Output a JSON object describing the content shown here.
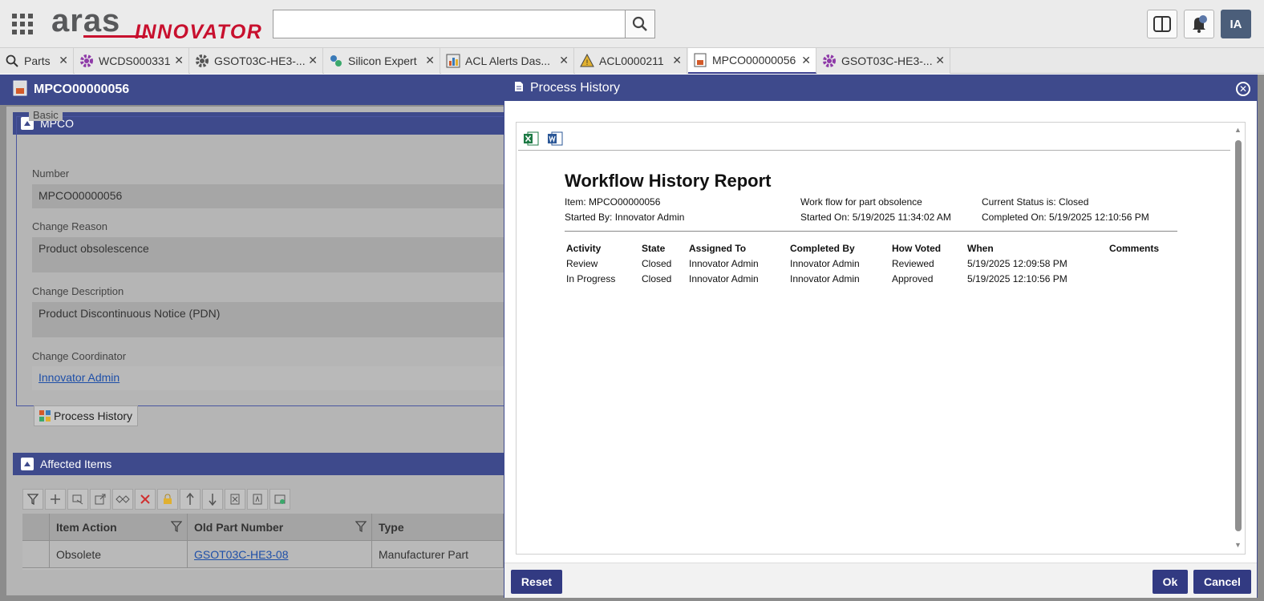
{
  "header": {
    "logo_aras": "aras",
    "logo_innovator": "INNOVATOR",
    "search": {
      "value": "",
      "placeholder": ""
    },
    "avatar": "IA",
    "notification_count": "1"
  },
  "tabs": [
    {
      "label": "Parts",
      "icon": "search-icon",
      "closable": false
    },
    {
      "label": "WCDS000331",
      "icon": "gear-icon",
      "closable": true
    },
    {
      "label": "GSOT03C-HE3-...",
      "icon": "gear-icon",
      "closable": true
    },
    {
      "label": "Silicon Expert",
      "icon": "silicon-expert-icon",
      "closable": true
    },
    {
      "label": "ACL Alerts Das...",
      "icon": "chart-icon",
      "closable": true
    },
    {
      "label": "ACL0000211",
      "icon": "warning-icon",
      "closable": true
    },
    {
      "label": "MPCO00000056",
      "icon": "document-icon",
      "closable": true,
      "active": true
    },
    {
      "label": "GSOT03C-HE3-...",
      "icon": "gear-icon",
      "closable": true
    }
  ],
  "item": {
    "title": "MPCO00000056",
    "section_label": "MPCO",
    "group_label": "Basic",
    "fields": {
      "number_label": "Number",
      "number_value": "MPCO00000056",
      "reason_label": "Change Reason",
      "reason_value": "Product obsolescence",
      "description_label": "Change Description",
      "description_value": "Product Discontinuous Notice (PDN)",
      "coordinator_label": "Change Coordinator",
      "coordinator_value": "Innovator Admin"
    },
    "process_history_button": "Process History"
  },
  "affected": {
    "section_label": "Affected Items",
    "columns": [
      "Item Action",
      "Old Part Number",
      "Type"
    ],
    "rows": [
      {
        "action": "Obsolete",
        "old_part": "GSOT03C-HE3-08",
        "type": "Manufacturer Part"
      }
    ]
  },
  "dialog": {
    "title": "Process History",
    "report": {
      "title": "Workflow History Report",
      "item": "Item: MPCO00000056",
      "workflow": "Work flow for part obsolence",
      "status": "Current Status is: Closed",
      "started_by": "Started By: Innovator Admin",
      "started_on": "Started On: 5/19/2025 11:34:02 AM",
      "completed_on": "Completed On: 5/19/2025 12:10:56 PM",
      "columns": [
        "Activity",
        "State",
        "Assigned To",
        "Completed By",
        "How Voted",
        "When",
        "Comments"
      ],
      "rows": [
        [
          "Review",
          "Closed",
          "Innovator Admin",
          "Innovator Admin",
          "Reviewed",
          "5/19/2025 12:09:58 PM",
          ""
        ],
        [
          "In Progress",
          "Closed",
          "Innovator Admin",
          "Innovator Admin",
          "Approved",
          "5/19/2025 12:10:56 PM",
          ""
        ]
      ]
    },
    "reset_label": "Reset",
    "ok_label": "Ok",
    "cancel_label": "Cancel"
  },
  "colors": {
    "accent": "#3e4a8c",
    "brand_red": "#c8102e",
    "link": "#1e4fa8"
  }
}
